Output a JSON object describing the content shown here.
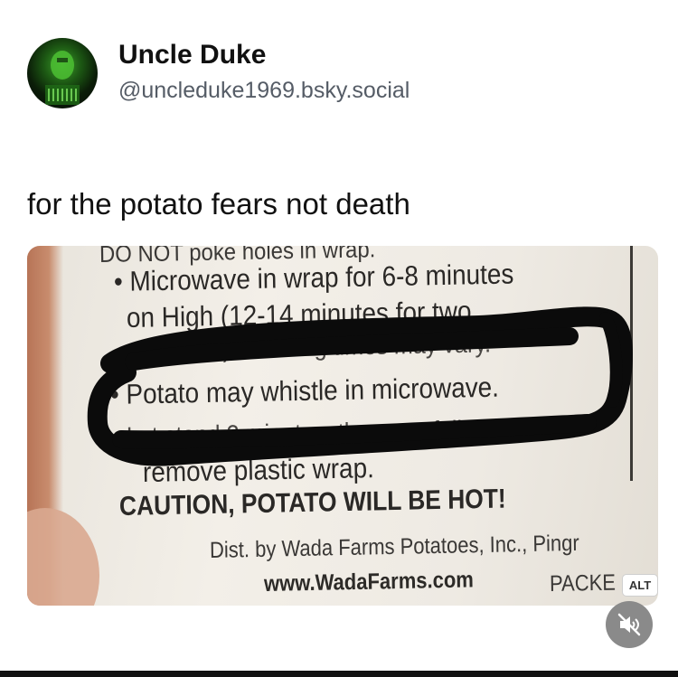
{
  "author": {
    "display_name": "Uncle Duke",
    "handle": "@uncleduke1969.bsky.social",
    "avatar_icon": "avatar-portrait"
  },
  "post": {
    "text": "for the potato fears not death"
  },
  "media": {
    "label_lines": {
      "cut_top": "DO NOT poke holes in wrap.",
      "line1": "• Microwave in wrap for 6-8 minutes",
      "line2": "on High (12-14 minutes for two",
      "line3": "potatoes). Cooking times may vary.",
      "line4": "• Potato may whistle in microwave.",
      "line5": "Let stand 2 minutes, then carefully",
      "line6": "remove plastic wrap.",
      "line7": "CAUTION, POTATO WILL BE HOT!",
      "line8": "Dist. by Wada Farms Potatoes, Inc., Pingr",
      "line9": "www.WadaFarms.com",
      "line10": "PACKE"
    },
    "alt_badge": "ALT",
    "mute_icon": "speaker-muted-icon",
    "marker_color": "#0b0b0b"
  }
}
